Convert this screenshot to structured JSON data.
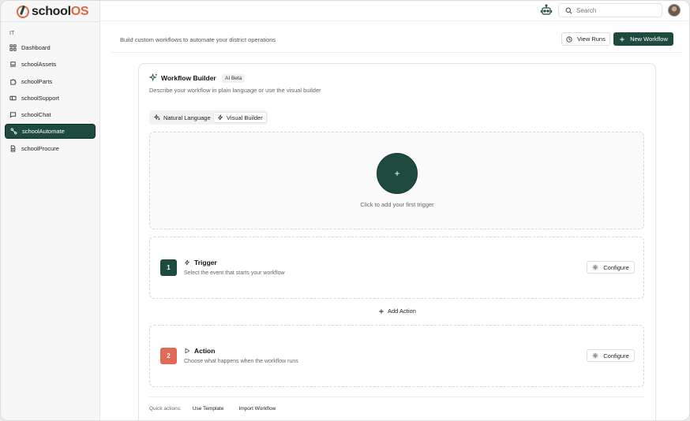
{
  "brand": {
    "name_prefix": "school",
    "name_suffix": "OS",
    "accent": "#e2663f",
    "primary": "#1f4a3f"
  },
  "sidebar": {
    "section_label": "IT",
    "items": [
      {
        "label": "Dashboard",
        "icon": "grid-icon",
        "active": false
      },
      {
        "label": "schoolAssets",
        "icon": "laptop-icon",
        "active": false
      },
      {
        "label": "schoolParts",
        "icon": "puzzle-icon",
        "active": false
      },
      {
        "label": "schoolSupport",
        "icon": "ticket-icon",
        "active": false
      },
      {
        "label": "schoolChat",
        "icon": "chat-icon",
        "active": false
      },
      {
        "label": "schoolAutomate",
        "icon": "workflow-icon",
        "active": true
      },
      {
        "label": "schoolProcure",
        "icon": "document-icon",
        "active": false
      }
    ]
  },
  "topbar": {
    "search_placeholder": "Search"
  },
  "header": {
    "subtitle": "Build custom workflows to automate your district operations",
    "view_runs": "View Runs",
    "new_workflow": "New Workflow"
  },
  "builder": {
    "title": "Workflow Builder",
    "badge": "AI Beta",
    "description": "Describe your workflow in plain language or use the visual builder",
    "modes": {
      "natural_language": "Natural Language",
      "visual_builder": "Visual Builder",
      "selected": "Visual Builder"
    },
    "add_trigger_symbol": "+",
    "add_trigger_label": "Click to add your first trigger",
    "steps": [
      {
        "number": "1",
        "title": "Trigger",
        "description": "Select the event that starts your workflow",
        "configure": "Configure",
        "color": "#1f4a3f"
      },
      {
        "number": "2",
        "title": "Action",
        "description": "Choose what happens when the workflow runs",
        "configure": "Configure",
        "color": "#e06a55"
      }
    ],
    "add_action": "Add Action",
    "quick_actions": {
      "label": "Quick actions:",
      "use_template": "Use Template",
      "import_workflow": "Import Workflow"
    }
  }
}
